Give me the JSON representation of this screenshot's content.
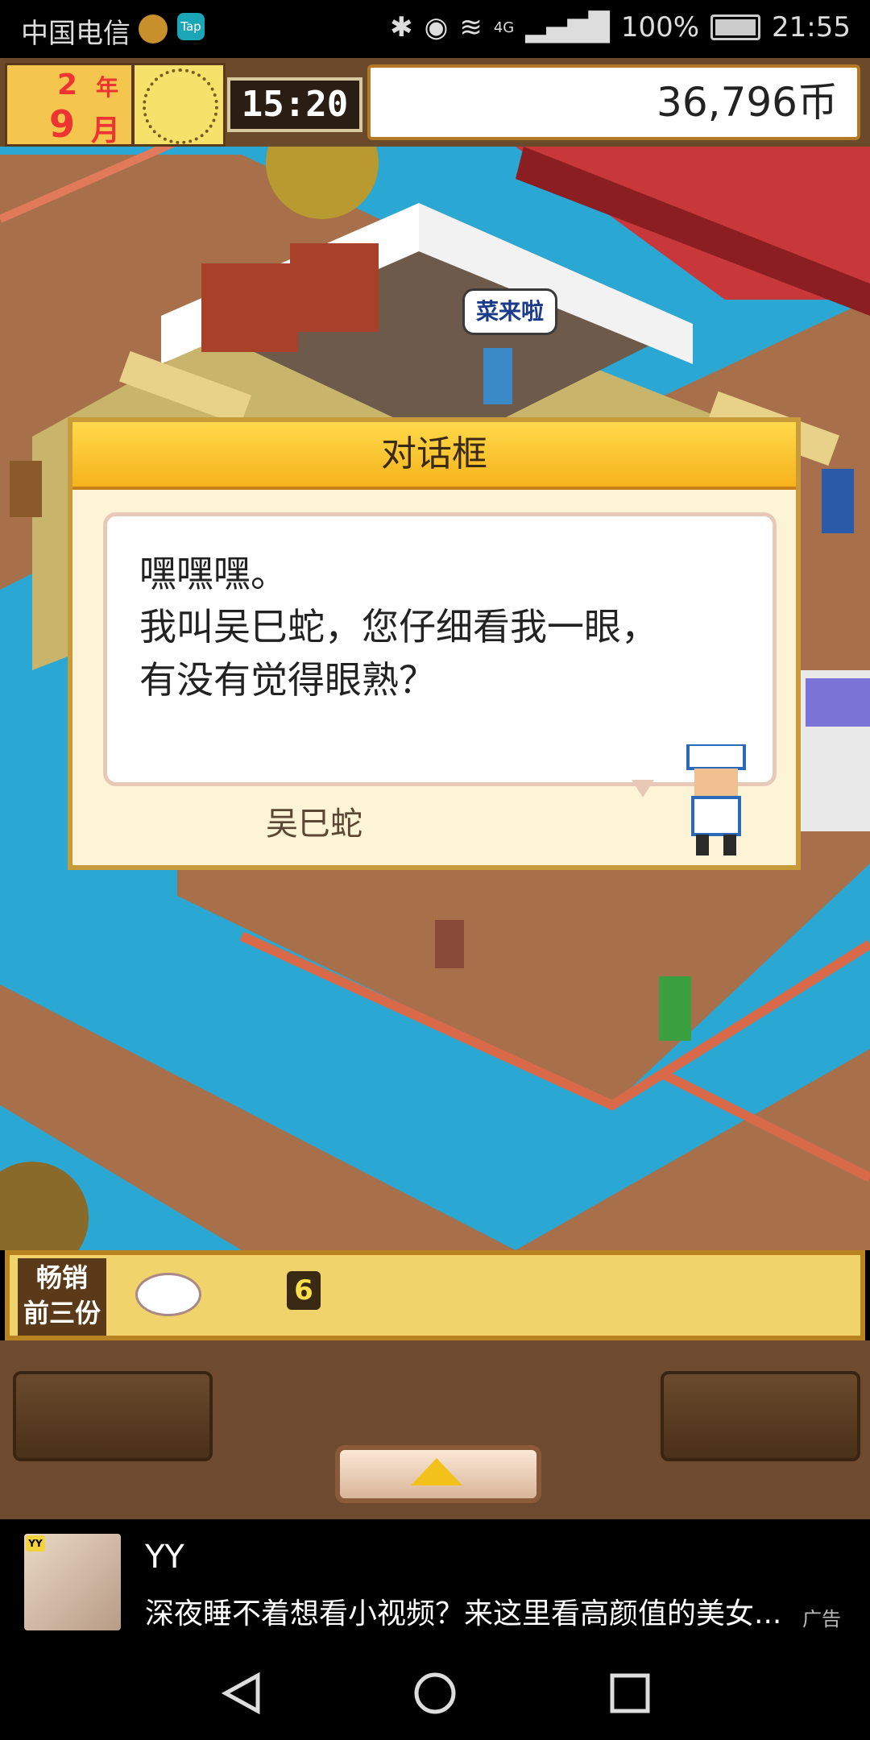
{
  "status_bar": {
    "carrier": "中国电信",
    "tap_badge": "Tap",
    "network": "4G",
    "battery": "100%",
    "time": "21:55"
  },
  "hud": {
    "year": "2",
    "year_label": "年",
    "month": "9",
    "month_label": "月",
    "game_time": "15:20",
    "money": "36,796币"
  },
  "npc_bubble": "菜来啦",
  "dialog": {
    "title": "对话框",
    "lines": [
      "嘿嘿嘿。",
      "我叫吴巳蛇，您仔细看我一眼，",
      "有没有觉得眼熟？"
    ],
    "speaker": "吴巳蛇"
  },
  "bestseller": {
    "label_line1": "畅销",
    "label_line2": "前三份",
    "count": "6"
  },
  "ad": {
    "badge": "YY",
    "title": "YY",
    "description": "深夜睡不着想看小视频？来这里看高颜值的美女...",
    "marker": "广告"
  },
  "colors": {
    "water": "#2aa7d2",
    "deck": "#a7704a",
    "dialog_header": "#f6b31c"
  }
}
